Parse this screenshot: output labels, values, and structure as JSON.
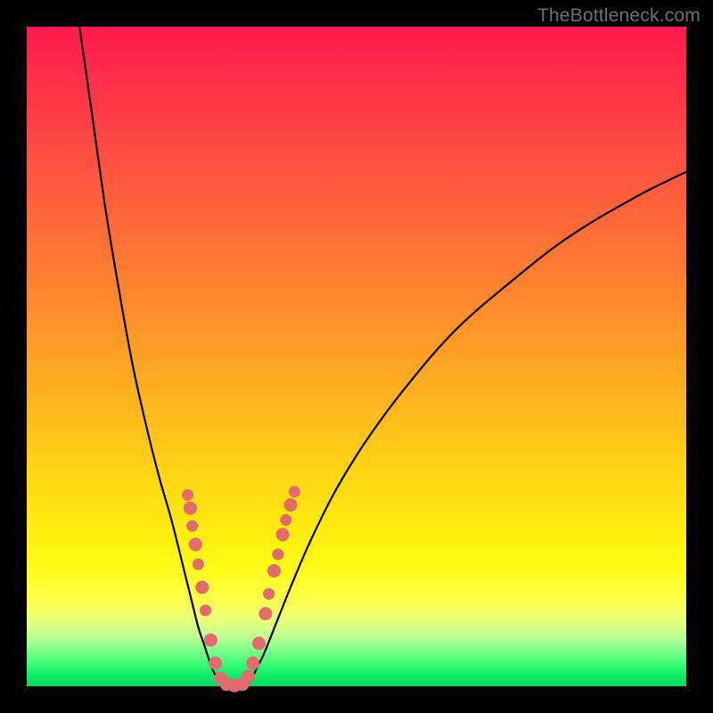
{
  "watermark": "TheBottleneck.com",
  "chart_data": {
    "type": "line",
    "title": "",
    "xlabel": "",
    "ylabel": "",
    "xlim": [
      0,
      100
    ],
    "ylim": [
      0,
      100
    ],
    "grid": false,
    "legend": false,
    "background": {
      "gradient": "vertical",
      "stops": [
        {
          "pos": 0.0,
          "color": "#ff1a4d"
        },
        {
          "pos": 0.3,
          "color": "#ff6a38"
        },
        {
          "pos": 0.55,
          "color": "#ffaf20"
        },
        {
          "pos": 0.82,
          "color": "#fffb18"
        },
        {
          "pos": 0.94,
          "color": "#8fff8e"
        },
        {
          "pos": 1.0,
          "color": "#07d85e"
        }
      ]
    },
    "series": [
      {
        "name": "left-branch",
        "stroke": "#000000",
        "x": [
          8,
          10,
          12,
          14,
          16,
          18,
          20,
          22,
          24,
          25,
          26,
          27,
          28,
          29,
          30
        ],
        "y": [
          100,
          86,
          72,
          60,
          49,
          40,
          32,
          25,
          17,
          13,
          9,
          6,
          3,
          1,
          0
        ]
      },
      {
        "name": "right-branch",
        "stroke": "#000000",
        "x": [
          33,
          34,
          35,
          36,
          38,
          40,
          43,
          47,
          52,
          58,
          65,
          73,
          82,
          92,
          100
        ],
        "y": [
          0,
          1,
          3,
          5,
          10,
          15,
          22,
          30,
          38,
          46,
          54,
          61,
          68,
          74,
          78
        ]
      }
    ],
    "scatter_markers": {
      "color": "#e46a6d",
      "radius_range": [
        5,
        9
      ],
      "points": [
        {
          "x": 24.4,
          "y": 29.0,
          "r": 6
        },
        {
          "x": 24.8,
          "y": 27.0,
          "r": 7
        },
        {
          "x": 25.1,
          "y": 24.3,
          "r": 6
        },
        {
          "x": 25.6,
          "y": 21.5,
          "r": 7
        },
        {
          "x": 26.0,
          "y": 18.5,
          "r": 6
        },
        {
          "x": 26.6,
          "y": 15.0,
          "r": 7
        },
        {
          "x": 27.1,
          "y": 11.5,
          "r": 6
        },
        {
          "x": 27.9,
          "y": 7.0,
          "r": 7
        },
        {
          "x": 28.6,
          "y": 3.5,
          "r": 7
        },
        {
          "x": 29.4,
          "y": 1.2,
          "r": 7
        },
        {
          "x": 30.3,
          "y": 0.3,
          "r": 7
        },
        {
          "x": 31.5,
          "y": 0.1,
          "r": 7
        },
        {
          "x": 32.7,
          "y": 0.3,
          "r": 7
        },
        {
          "x": 33.6,
          "y": 1.5,
          "r": 7
        },
        {
          "x": 34.3,
          "y": 3.5,
          "r": 7
        },
        {
          "x": 35.2,
          "y": 6.5,
          "r": 7
        },
        {
          "x": 36.2,
          "y": 11.0,
          "r": 7
        },
        {
          "x": 36.7,
          "y": 14.0,
          "r": 6
        },
        {
          "x": 37.5,
          "y": 17.5,
          "r": 7
        },
        {
          "x": 38.1,
          "y": 20.0,
          "r": 6
        },
        {
          "x": 38.8,
          "y": 23.0,
          "r": 7
        },
        {
          "x": 39.3,
          "y": 25.2,
          "r": 6
        },
        {
          "x": 40.0,
          "y": 27.5,
          "r": 7
        },
        {
          "x": 40.6,
          "y": 29.5,
          "r": 6
        }
      ]
    }
  }
}
